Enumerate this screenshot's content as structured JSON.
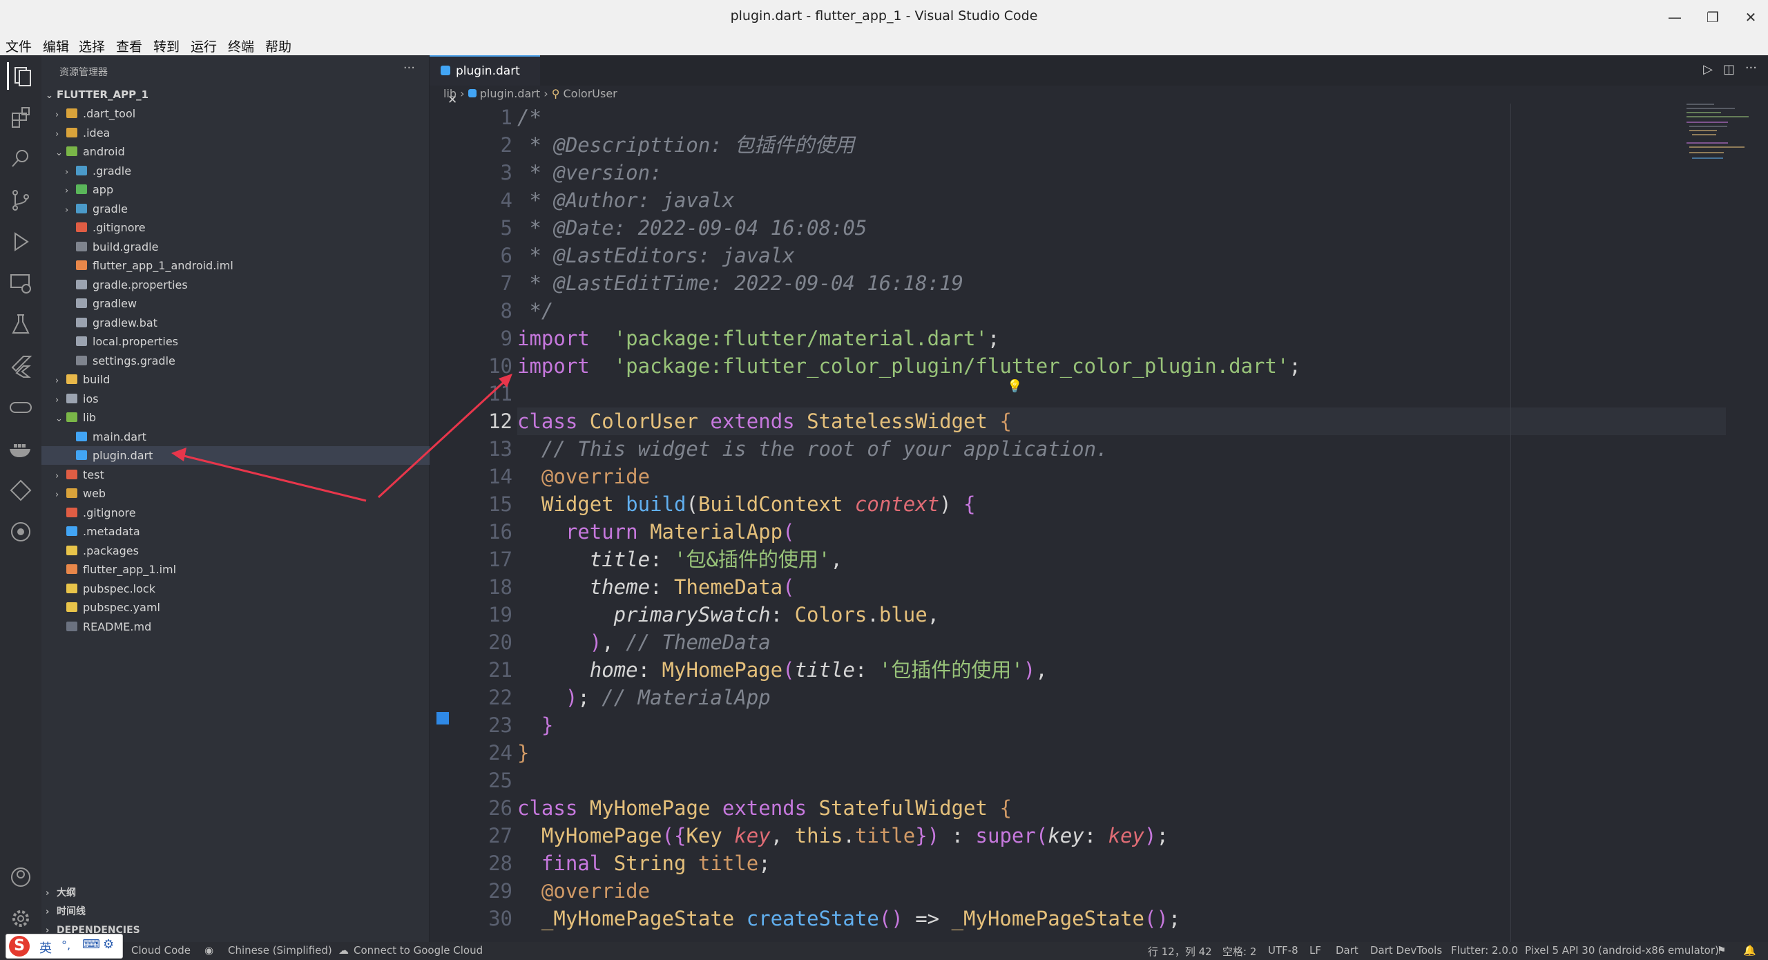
{
  "window": {
    "title": "plugin.dart - flutter_app_1 - Visual Studio Code"
  },
  "menu": [
    "文件",
    "编辑",
    "选择",
    "查看",
    "转到",
    "运行",
    "终端",
    "帮助"
  ],
  "sidebar": {
    "header": "资源管理器",
    "more": "···",
    "root": "FLUTTER_APP_1",
    "items": [
      {
        "label": ".dart_tool",
        "depth": 1,
        "chev": "›",
        "color": "#d9a33b"
      },
      {
        "label": ".idea",
        "depth": 1,
        "chev": "›",
        "color": "#d9a33b"
      },
      {
        "label": "android",
        "depth": 1,
        "chev": "⌄",
        "color": "#7ab648"
      },
      {
        "label": ".gradle",
        "depth": 2,
        "chev": "›",
        "color": "#4b9ac9"
      },
      {
        "label": "app",
        "depth": 2,
        "chev": "›",
        "color": "#5ab65a"
      },
      {
        "label": "gradle",
        "depth": 2,
        "chev": "›",
        "color": "#4b9ac9"
      },
      {
        "label": ".gitignore",
        "depth": 2,
        "chev": "",
        "color": "#e05d44"
      },
      {
        "label": "build.gradle",
        "depth": 2,
        "chev": "",
        "color": "#7f848e"
      },
      {
        "label": "flutter_app_1_android.iml",
        "depth": 2,
        "chev": "",
        "color": "#e8874a"
      },
      {
        "label": "gradle.properties",
        "depth": 2,
        "chev": "",
        "color": "#9ba3b0"
      },
      {
        "label": "gradlew",
        "depth": 2,
        "chev": "",
        "color": "#9ba3b0"
      },
      {
        "label": "gradlew.bat",
        "depth": 2,
        "chev": "",
        "color": "#9ba3b0"
      },
      {
        "label": "local.properties",
        "depth": 2,
        "chev": "",
        "color": "#9ba3b0"
      },
      {
        "label": "settings.gradle",
        "depth": 2,
        "chev": "",
        "color": "#7f848e"
      },
      {
        "label": "build",
        "depth": 1,
        "chev": "›",
        "color": "#e8b84a"
      },
      {
        "label": "ios",
        "depth": 1,
        "chev": "›",
        "color": "#9ba3b0"
      },
      {
        "label": "lib",
        "depth": 1,
        "chev": "⌄",
        "color": "#7ab648"
      },
      {
        "label": "main.dart",
        "depth": 2,
        "chev": "",
        "color": "#42a5f5"
      },
      {
        "label": "plugin.dart",
        "depth": 2,
        "chev": "",
        "color": "#42a5f5",
        "selected": true
      },
      {
        "label": "test",
        "depth": 1,
        "chev": "›",
        "color": "#e05d44"
      },
      {
        "label": "web",
        "depth": 1,
        "chev": "›",
        "color": "#d9a33b"
      },
      {
        "label": ".gitignore",
        "depth": 1,
        "chev": "",
        "color": "#e05d44"
      },
      {
        "label": ".metadata",
        "depth": 1,
        "chev": "",
        "color": "#42a5f5"
      },
      {
        "label": ".packages",
        "depth": 1,
        "chev": "",
        "color": "#e8c44a"
      },
      {
        "label": "flutter_app_1.iml",
        "depth": 1,
        "chev": "",
        "color": "#e8874a"
      },
      {
        "label": "pubspec.lock",
        "depth": 1,
        "chev": "",
        "color": "#e8c44a"
      },
      {
        "label": "pubspec.yaml",
        "depth": 1,
        "chev": "",
        "color": "#e8c44a"
      },
      {
        "label": "README.md",
        "depth": 1,
        "chev": "",
        "color": "#6b7280"
      }
    ],
    "sections": [
      "大纲",
      "时间线",
      "DEPENDENCIES"
    ]
  },
  "editor": {
    "tab": "plugin.dart",
    "breadcrumb": [
      "lib",
      "plugin.dart",
      "ColorUser"
    ],
    "current_line": 12,
    "lines": [
      [
        [
          "cm",
          "/*"
        ]
      ],
      [
        [
          "cm",
          " * @Descripttion: 包插件的使用"
        ]
      ],
      [
        [
          "cm",
          " * @version:"
        ]
      ],
      [
        [
          "cm",
          " * @Author: javalx"
        ]
      ],
      [
        [
          "cm",
          " * @Date: 2022-09-04 16:08:05"
        ]
      ],
      [
        [
          "cm",
          " * @LastEditors: javalx"
        ]
      ],
      [
        [
          "cm",
          " * @LastEditTime: 2022-09-04 16:18:19"
        ]
      ],
      [
        [
          "cm",
          " */"
        ]
      ],
      [
        [
          "kw",
          "import"
        ],
        [
          "",
          "  "
        ],
        [
          "str",
          "'package:flutter/material.dart'"
        ],
        [
          "",
          ";"
        ]
      ],
      [
        [
          "kw",
          "import"
        ],
        [
          "",
          "  "
        ],
        [
          "str",
          "'package:flutter_color_plugin/flutter_color_plugin.dart'"
        ],
        [
          "",
          ";"
        ]
      ],
      [
        [
          "",
          ""
        ]
      ],
      [
        [
          "kw",
          "class"
        ],
        [
          "",
          " "
        ],
        [
          "cls",
          "ColorUser"
        ],
        [
          "",
          " "
        ],
        [
          "kw",
          "extends"
        ],
        [
          "",
          " "
        ],
        [
          "cls",
          "StatelessWidget"
        ],
        [
          "",
          " "
        ],
        [
          "meta",
          "{"
        ]
      ],
      [
        [
          "cm",
          "  // This widget is the root of your application."
        ]
      ],
      [
        [
          "meta",
          "  @override"
        ]
      ],
      [
        [
          "cls",
          "  Widget"
        ],
        [
          "",
          " "
        ],
        [
          "fn",
          "build"
        ],
        [
          "",
          "("
        ],
        [
          "cls",
          "BuildContext"
        ],
        [
          "",
          " "
        ],
        [
          "prm",
          "context"
        ],
        [
          "",
          ") "
        ],
        [
          "kw",
          "{"
        ]
      ],
      [
        [
          "kw",
          "    return"
        ],
        [
          "",
          " "
        ],
        [
          "cls",
          "MaterialApp"
        ],
        [
          "kw",
          "("
        ]
      ],
      [
        [
          "prop",
          "      title"
        ],
        [
          "",
          ": "
        ],
        [
          "str",
          "'包&插件的使用'"
        ],
        [
          "",
          ","
        ]
      ],
      [
        [
          "prop",
          "      theme"
        ],
        [
          "",
          ": "
        ],
        [
          "cls",
          "ThemeData"
        ],
        [
          "kw",
          "("
        ]
      ],
      [
        [
          "prop",
          "        primarySwatch"
        ],
        [
          "",
          ": "
        ],
        [
          "cls",
          "Colors"
        ],
        [
          "",
          "."
        ],
        [
          "cls",
          "blue"
        ],
        [
          "",
          ","
        ]
      ],
      [
        [
          "",
          "      "
        ],
        [
          "kw",
          ")"
        ],
        [
          "",
          ", "
        ],
        [
          "cm",
          "// ThemeData"
        ]
      ],
      [
        [
          "prop",
          "      home"
        ],
        [
          "",
          ": "
        ],
        [
          "cls",
          "MyHomePage"
        ],
        [
          "kw",
          "("
        ],
        [
          "prop",
          "title"
        ],
        [
          "",
          ": "
        ],
        [
          "str",
          "'包插件的使用'"
        ],
        [
          "kw",
          ")"
        ],
        [
          "",
          ","
        ]
      ],
      [
        [
          "",
          "    "
        ],
        [
          "kw",
          ")"
        ],
        [
          "",
          "; "
        ],
        [
          "cm",
          "// MaterialApp"
        ]
      ],
      [
        [
          "kw",
          "  }"
        ]
      ],
      [
        [
          "meta",
          "}"
        ]
      ],
      [
        [
          "",
          ""
        ]
      ],
      [
        [
          "kw",
          "class"
        ],
        [
          "",
          " "
        ],
        [
          "cls",
          "MyHomePage"
        ],
        [
          "",
          " "
        ],
        [
          "kw",
          "extends"
        ],
        [
          "",
          " "
        ],
        [
          "cls",
          "StatefulWidget"
        ],
        [
          "",
          " "
        ],
        [
          "meta",
          "{"
        ]
      ],
      [
        [
          "cls",
          "  MyHomePage"
        ],
        [
          "kw",
          "({"
        ],
        [
          "cls",
          "Key"
        ],
        [
          "",
          " "
        ],
        [
          "prm",
          "key"
        ],
        [
          "",
          ", "
        ],
        [
          "cls",
          "this"
        ],
        [
          "",
          ".",
          ""
        ],
        [
          "meta",
          "title"
        ],
        [
          "kw",
          "})"
        ],
        [
          "",
          " : "
        ],
        [
          "kw",
          "super"
        ],
        [
          "kw",
          "("
        ],
        [
          "prop",
          "key"
        ],
        [
          "",
          ": "
        ],
        [
          "prm",
          "key"
        ],
        [
          "kw",
          ")"
        ],
        [
          "",
          ";"
        ]
      ],
      [
        [
          "kw",
          "  final"
        ],
        [
          "",
          " "
        ],
        [
          "cls",
          "String"
        ],
        [
          "",
          " "
        ],
        [
          "meta",
          "title"
        ],
        [
          "",
          ";"
        ]
      ],
      [
        [
          "meta",
          "  @override"
        ]
      ],
      [
        [
          "cls",
          "  _MyHomePageState"
        ],
        [
          "",
          " "
        ],
        [
          "fn",
          "createState"
        ],
        [
          "kw",
          "()"
        ],
        [
          "",
          " => "
        ],
        [
          "cls",
          "_MyHomePageState"
        ],
        [
          "kw",
          "()"
        ],
        [
          "",
          ";"
        ]
      ]
    ]
  },
  "status": {
    "cloud_code": "Cloud Code",
    "language": "Chinese (Simplified)",
    "connect": "Connect to Google Cloud",
    "position": "行 12，列 42",
    "spaces": "空格: 2",
    "encoding": "UTF-8",
    "eol": "LF",
    "lang": "Dart",
    "devtools": "Dart DevTools",
    "flutter": "Flutter: 2.0.0",
    "device": "Pixel 5 API 30 (android-x86 emulator)"
  },
  "ime": {
    "label": "英"
  }
}
